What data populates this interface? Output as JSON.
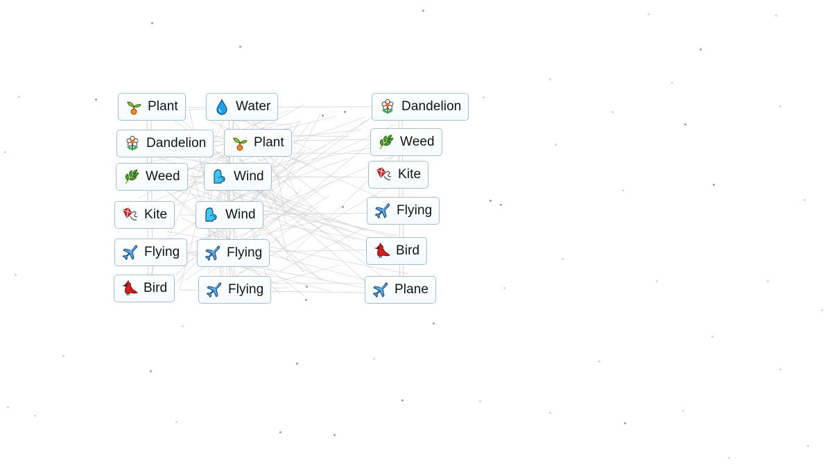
{
  "app": "Infinite Craft canvas",
  "tiles": [
    {
      "label": "Plant",
      "icon": "plant-sprout-icon",
      "emoji": "plant"
    },
    {
      "label": "Water",
      "icon": "water-drop-icon",
      "emoji": "water"
    },
    {
      "label": "Dandelion",
      "icon": "flower-icon",
      "emoji": "flower"
    },
    {
      "label": "Plant",
      "icon": "plant-sprout-icon",
      "emoji": "plant"
    },
    {
      "label": "Weed",
      "icon": "leaf-icon",
      "emoji": "leaf"
    },
    {
      "label": "Wind",
      "icon": "wind-face-icon",
      "emoji": "wind"
    },
    {
      "label": "Kite",
      "icon": "kite-icon",
      "emoji": "kite"
    },
    {
      "label": "Wind",
      "icon": "wind-face-icon",
      "emoji": "wind"
    },
    {
      "label": "Flying",
      "icon": "airplane-icon",
      "emoji": "plane"
    },
    {
      "label": "Flying",
      "icon": "airplane-icon",
      "emoji": "plane"
    },
    {
      "label": "Bird",
      "icon": "bird-icon",
      "emoji": "bird"
    },
    {
      "label": "Flying",
      "icon": "airplane-icon",
      "emoji": "plane"
    },
    {
      "label": "Dandelion",
      "icon": "flower-icon",
      "emoji": "flower"
    },
    {
      "label": "Weed",
      "icon": "leaf-icon",
      "emoji": "leaf"
    },
    {
      "label": "Kite",
      "icon": "kite-icon",
      "emoji": "kite"
    },
    {
      "label": "Flying",
      "icon": "airplane-icon",
      "emoji": "plane"
    },
    {
      "label": "Bird",
      "icon": "bird-icon",
      "emoji": "bird"
    },
    {
      "label": "Plane",
      "icon": "airplane-icon",
      "emoji": "plane"
    }
  ]
}
